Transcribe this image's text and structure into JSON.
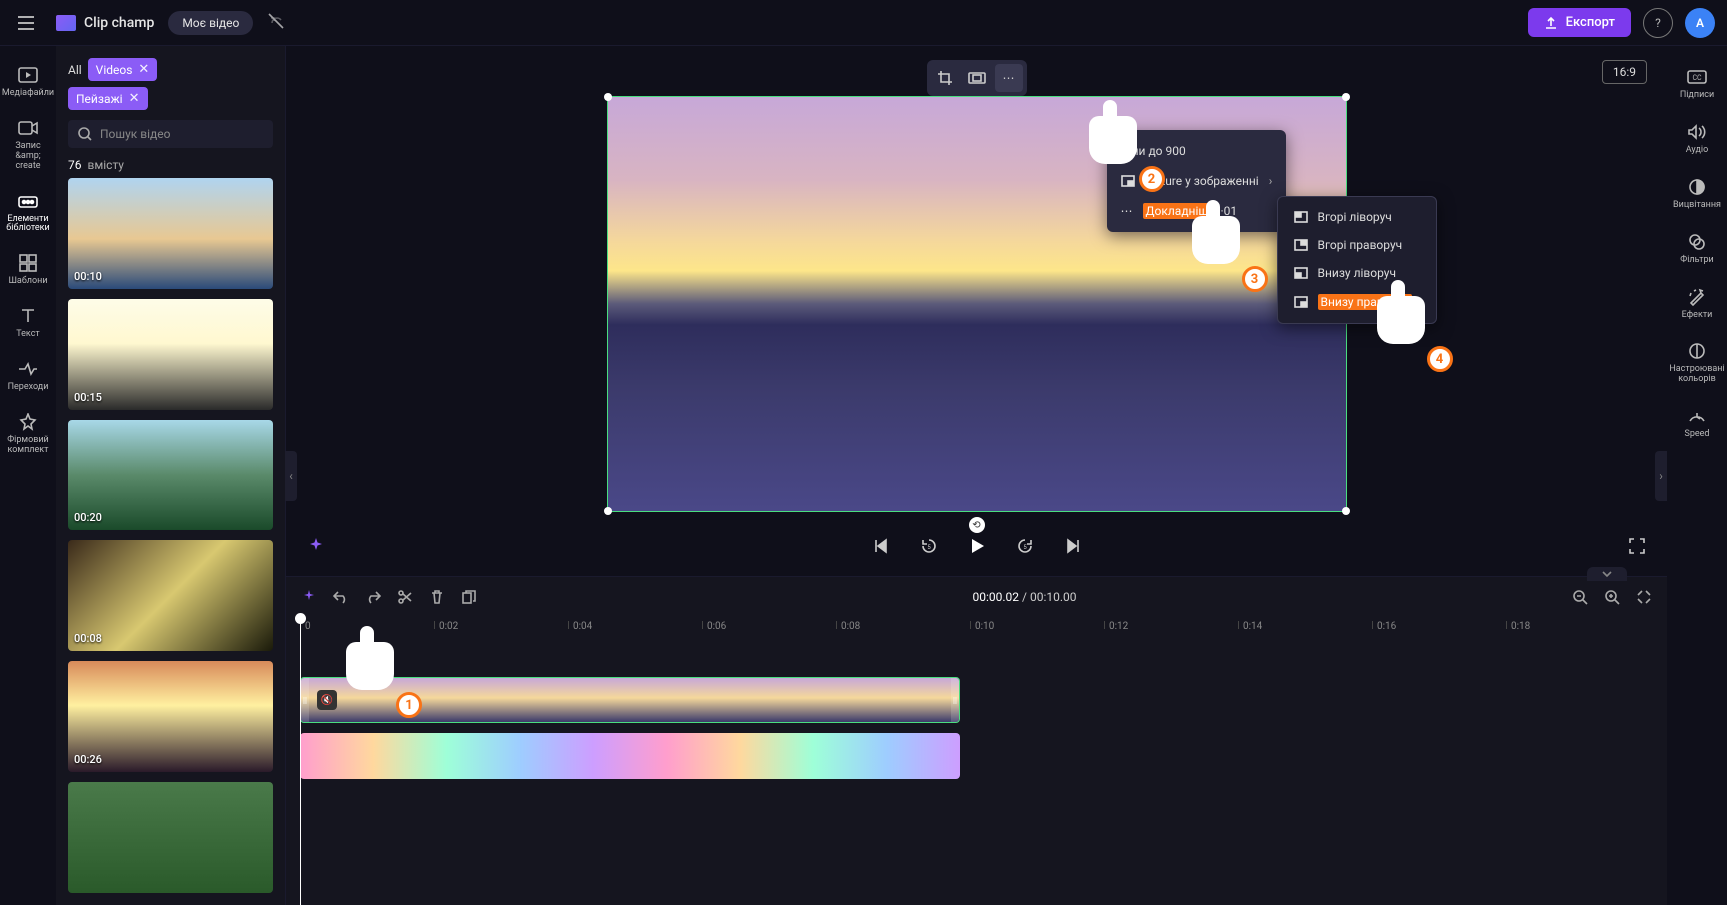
{
  "header": {
    "app_name": "Clip champ",
    "project_name": "Моє відео",
    "export_label": "Експорт",
    "avatar_initial": "A"
  },
  "left_rail": [
    {
      "key": "media",
      "label": "Медіафайли"
    },
    {
      "key": "record",
      "label": "Запис &amp; create"
    },
    {
      "key": "library",
      "label": "Елементи бібліотеки"
    },
    {
      "key": "templates",
      "label": "Шаблони"
    },
    {
      "key": "text",
      "label": "Текст"
    },
    {
      "key": "transitions",
      "label": "Переходи"
    },
    {
      "key": "brand",
      "label": "Фірмовий комплект"
    }
  ],
  "media_panel": {
    "breadcrumb_label": "All",
    "chip_videos": "Videos",
    "chip_tag": "Пейзажі",
    "search_placeholder": "Пошук відео",
    "count_number": "76",
    "count_label": "вмісту",
    "thumbs": [
      {
        "duration": "00:10",
        "bg": "linear-gradient(180deg,#b0d4f0 0%,#e8c892 55%,#2a4a7a 100%)"
      },
      {
        "duration": "00:15",
        "bg": "linear-gradient(180deg,#fefce8 0%,#fff8d0 40%,#2a2a2a 100%)"
      },
      {
        "duration": "00:20",
        "bg": "linear-gradient(180deg,#a8d8e8 0%,#5a8a6a 50%,#1a4a2a 100%)"
      },
      {
        "duration": "00:08",
        "bg": "linear-gradient(135deg,#3a2a1a 0%,#d8c870 50%,#1a1a0a 100%)"
      },
      {
        "duration": "00:26",
        "bg": "linear-gradient(180deg,#d88a5a 0%,#fff0a0 40%,#2a1a2a 100%)"
      },
      {
        "duration": "",
        "bg": "linear-gradient(180deg,#4a7a4a 0%,#2a5a2a 100%)"
      }
    ]
  },
  "preview": {
    "aspect_label": "16:9",
    "context_menu": {
      "item1": "з'їли до 900",
      "item2_prefix": "Picture",
      "item2_suffix": "у зображенні",
      "item3_label": "Докладніше",
      "item3_suffix": "·01"
    },
    "submenu": [
      "Вгорі ліворуч",
      "Вгорі праворуч",
      "Внизу ліворуч",
      "Внизу праворуч"
    ]
  },
  "callouts": [
    "1",
    "2",
    "3",
    "4"
  ],
  "timeline": {
    "current_time": "00:00.02",
    "total_time": "00:10.00",
    "ticks": [
      "0",
      "0:02",
      "0:04",
      "0:06",
      "0:08",
      "0:10",
      "0:12",
      "0:14",
      "0:16",
      "0:18"
    ]
  },
  "right_rail": [
    {
      "key": "captions",
      "label": "Підписи"
    },
    {
      "key": "audio",
      "label": "Аудіо"
    },
    {
      "key": "fade",
      "label": "Вицвітання"
    },
    {
      "key": "filters",
      "label": "Фільтри"
    },
    {
      "key": "effects",
      "label": "Ефекти"
    },
    {
      "key": "color",
      "label": "Настроювані кольорів"
    },
    {
      "key": "speed",
      "label": "Speed"
    }
  ]
}
